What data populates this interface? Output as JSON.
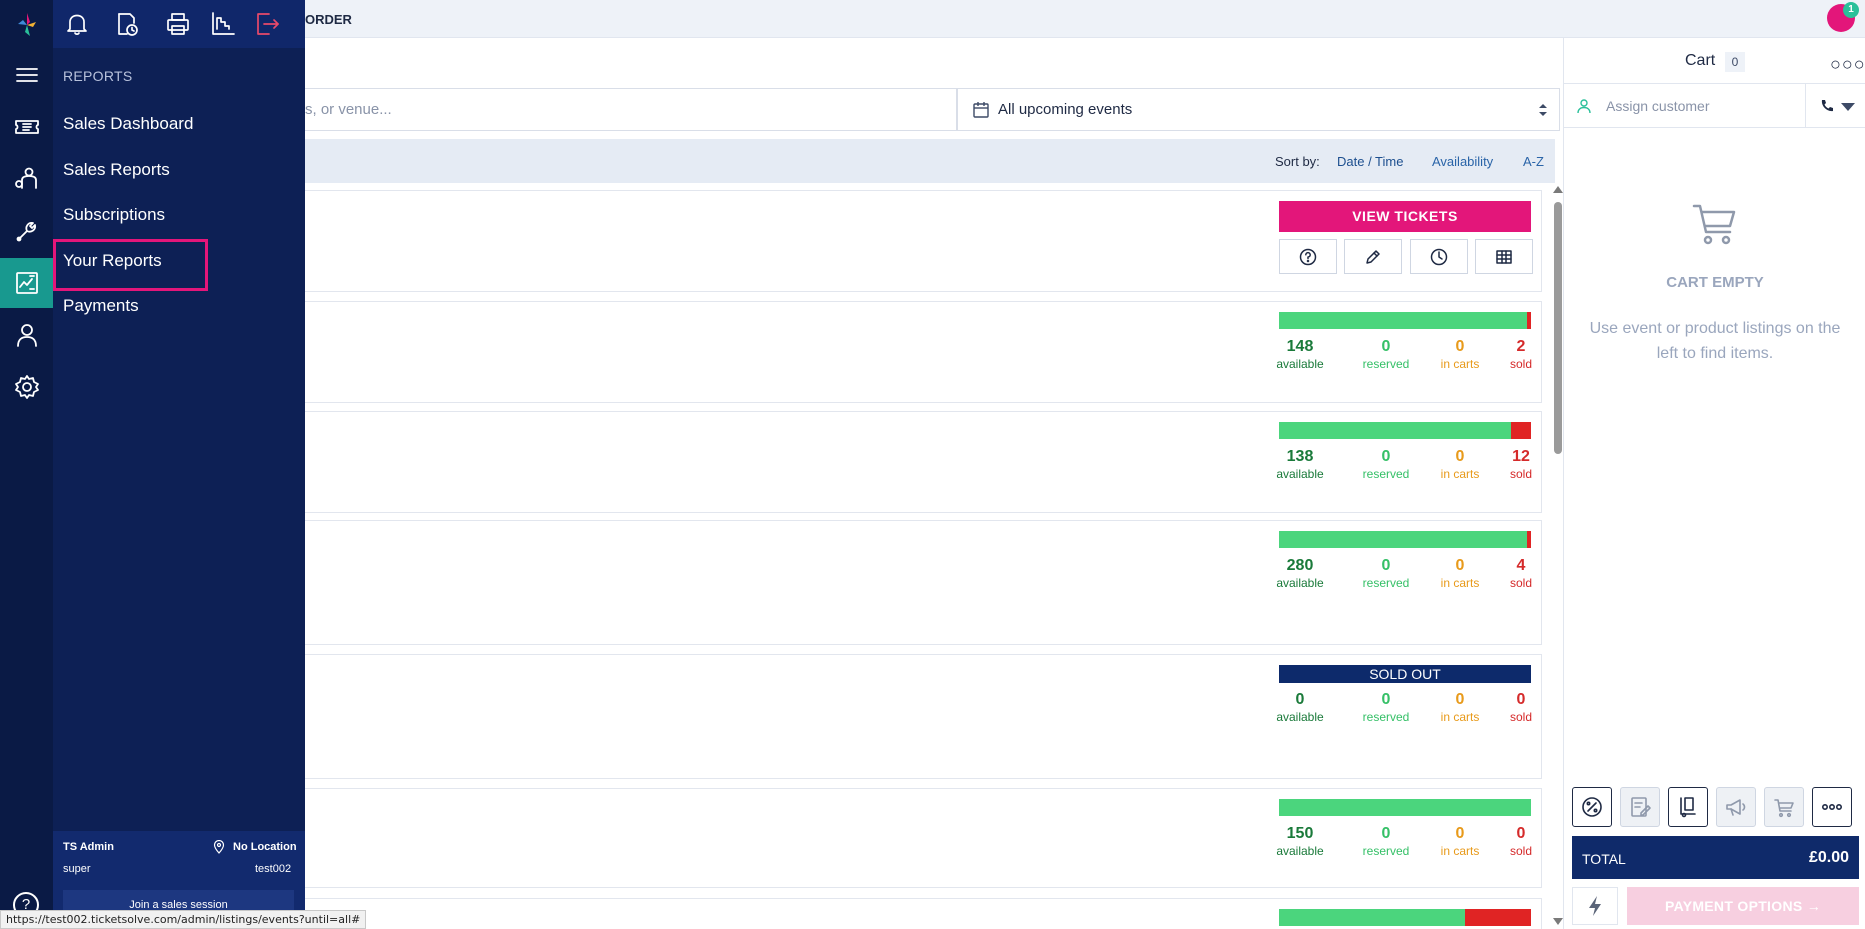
{
  "topbar": {
    "new_order_label": "ORDER",
    "notification_count": "1"
  },
  "menu": {
    "heading": "REPORTS",
    "items": [
      {
        "label": "Sales Dashboard"
      },
      {
        "label": "Sales Reports"
      },
      {
        "label": "Subscriptions"
      },
      {
        "label": "Your Reports"
      },
      {
        "label": "Payments"
      }
    ],
    "footer": {
      "user": "TS Admin",
      "location": "No Location",
      "role": "super",
      "account": "test002",
      "join_label": "Join a sales session"
    }
  },
  "search": {
    "placeholder_visible": "s, or venue...",
    "date_filter": "All upcoming events"
  },
  "sort": {
    "label": "Sort by:",
    "options": [
      "Date / Time",
      "Availability",
      "A-Z"
    ]
  },
  "events": [
    {
      "view_label": "VIEW TICKETS"
    },
    {
      "available": "148",
      "reserved": "0",
      "in_carts": "0",
      "sold": "2",
      "sold_fraction": 0.013
    },
    {
      "available": "138",
      "reserved": "0",
      "in_carts": "0",
      "sold": "12",
      "sold_fraction": 0.08
    },
    {
      "available": "280",
      "reserved": "0",
      "in_carts": "0",
      "sold": "4",
      "sold_fraction": 0.014
    },
    {
      "soldout_label": "SOLD OUT",
      "available": "0",
      "reserved": "0",
      "in_carts": "0",
      "sold": "0"
    },
    {
      "available": "150",
      "reserved": "0",
      "in_carts": "0",
      "sold": "0",
      "sold_fraction": 0
    },
    {
      "sold_fraction": 0.26
    }
  ],
  "stat_labels": {
    "available": "available",
    "reserved": "reserved",
    "in_carts": "in carts",
    "sold": "sold"
  },
  "cart": {
    "title": "Cart",
    "count": "0",
    "assign_placeholder": "Assign customer",
    "empty_title": "CART EMPTY",
    "empty_hint": "Use event or product listings on the left to find items.",
    "total_label": "TOTAL",
    "total_value": "£0.00",
    "payment_label": "PAYMENT OPTIONS"
  },
  "status_url": "https://test002.ticketsolve.com/admin/listings/events?until=all#",
  "colors": {
    "accent_pink": "#e3167a",
    "navy": "#0d2055",
    "teal": "#18998f",
    "available_green": "#4bd57d",
    "sold_red": "#e02424"
  }
}
